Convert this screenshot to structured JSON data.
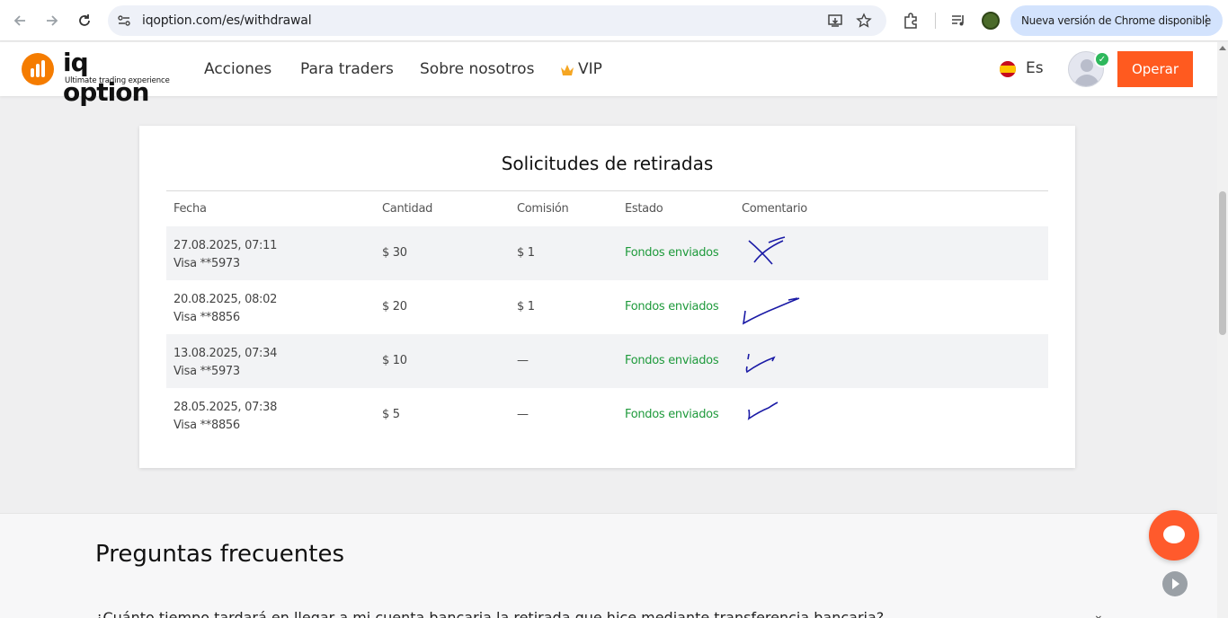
{
  "browser": {
    "url": "iqoption.com/es/withdrawal",
    "update_text": "Nueva versión de Chrome disponible"
  },
  "header": {
    "logo_name": "iq option",
    "logo_tagline": "Ultimate trading experience",
    "nav": [
      "Acciones",
      "Para traders",
      "Sobre nosotros",
      "VIP"
    ],
    "language": "Es",
    "cta_label": "Operar",
    "accent_color": "#ff5a1f"
  },
  "withdrawals": {
    "title": "Solicitudes de retiradas",
    "columns": [
      "Fecha",
      "Cantidad",
      "Comisión",
      "Estado",
      "Comentario"
    ],
    "rows": [
      {
        "date": "27.08.2025, 07:11",
        "card": "Visa **5973",
        "amount": "$ 30",
        "fee": "$ 1",
        "status": "Fondos enviados"
      },
      {
        "date": "20.08.2025, 08:02",
        "card": "Visa **8856",
        "amount": "$ 20",
        "fee": "$ 1",
        "status": "Fondos enviados"
      },
      {
        "date": "13.08.2025, 07:34",
        "card": "Visa **5973",
        "amount": "$ 10",
        "fee": "—",
        "status": "Fondos enviados"
      },
      {
        "date": "28.05.2025, 07:38",
        "card": "Visa **8856",
        "amount": "$ 5",
        "fee": "—",
        "status": "Fondos enviados"
      }
    ],
    "status_color": "#1f9a3c"
  },
  "faq": {
    "title": "Preguntas frecuentes",
    "first_question": "¿Cuánto tiempo tardará en llegar a mi cuenta bancaria la retirada que hice mediante transferencia bancaria?"
  }
}
